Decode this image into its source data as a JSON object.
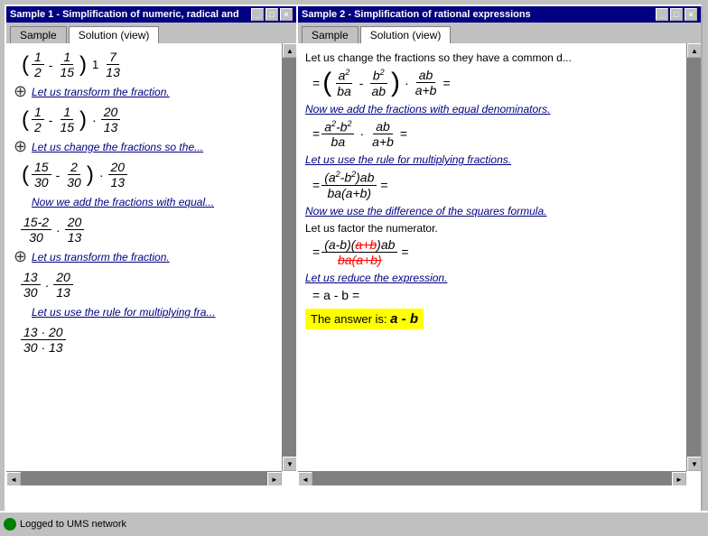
{
  "window1": {
    "title": "Sample 1 - Simplification of numeric, radical and",
    "tab_sample": "Sample",
    "tab_solution": "Solution (view)",
    "steps": [
      {
        "type": "math_fraction",
        "expr": "( 1/2 - 1/15 ) · 1 7/13"
      },
      {
        "type": "text",
        "text": "Let us transform the fraction."
      },
      {
        "type": "math_fraction",
        "expr": "( 1/2 - 1/15 ) · 20/13"
      },
      {
        "type": "text",
        "text": "Let us change the fractions so the..."
      },
      {
        "type": "math_fraction",
        "expr": "( 15/30 - 2/30 ) · 20/13"
      },
      {
        "type": "text",
        "text": "Now we add the fractions with equal..."
      },
      {
        "type": "math_fraction",
        "expr": "15-2/30 · 20/13"
      },
      {
        "type": "text",
        "text": "Let us transform the fraction."
      },
      {
        "type": "math_fraction",
        "expr": "13/30 · 20/13"
      },
      {
        "type": "text",
        "text": "Let us use the rule for multiplying fra..."
      },
      {
        "type": "math_fraction",
        "expr": "13·20 / 30·13"
      }
    ]
  },
  "window2": {
    "title": "Sample 2 - Simplification of rational expressions",
    "tab_sample": "Sample",
    "tab_solution": "Solution (view)",
    "steps": [
      {
        "type": "text",
        "text": "Let us change the fractions so they have a common d..."
      },
      {
        "type": "text_plain",
        "text": "Now we add the fractions with equal denominators."
      },
      {
        "type": "text_plain",
        "text": "Let us use the rule for multiplying fractions."
      },
      {
        "type": "text_plain",
        "text": "Now we use the difference of the squares formula."
      },
      {
        "type": "text_plain",
        "text": "Let us factor the numerator."
      },
      {
        "type": "text_plain",
        "text": "Let us reduce the expression."
      },
      {
        "type": "answer",
        "text": "The answer is:",
        "answer": "a - b"
      }
    ]
  },
  "taskbar": {
    "status_text": "Logged to UMS network"
  },
  "icons": {
    "down_arrow": "⊕",
    "scroll_up": "▲",
    "scroll_down": "▼",
    "scroll_left": "◄",
    "scroll_right": "►"
  }
}
